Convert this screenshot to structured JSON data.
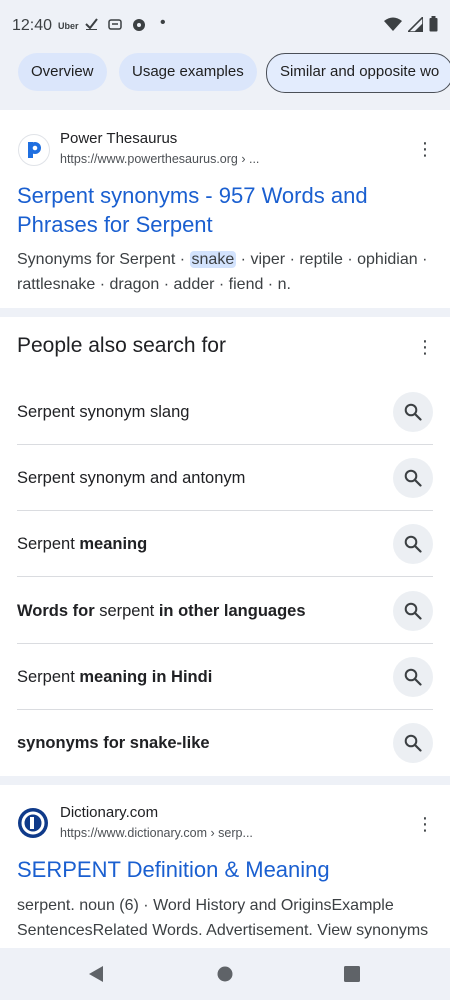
{
  "status": {
    "time": "12:40",
    "notif_uber": "Uber",
    "dot": "•"
  },
  "chips": [
    "Overview",
    "Usage examples",
    "Similar and opposite wo"
  ],
  "result1": {
    "site": "Power Thesaurus",
    "url": "https://www.powerthesaurus.org › ...",
    "title": "Serpent synonyms - 957 Words and Phrases for Serpent",
    "snippet_pre": "Synonyms for Serpent · ",
    "snippet_hl": "snake",
    "snippet_post": " · viper · reptile · ophidian · rattlesnake · dragon · adder · fiend · n."
  },
  "people_also_search": {
    "title": "People also search for",
    "items": [
      {
        "parts": [
          {
            "t": "Serpent synonym slang",
            "b": false
          }
        ]
      },
      {
        "parts": [
          {
            "t": "Serpent synonym and antonym",
            "b": false
          }
        ]
      },
      {
        "parts": [
          {
            "t": "Serpent ",
            "b": false
          },
          {
            "t": "meaning",
            "b": true
          }
        ]
      },
      {
        "parts": [
          {
            "t": "Words for",
            "b": true
          },
          {
            "t": " serpent ",
            "b": false
          },
          {
            "t": "in other languages",
            "b": true
          }
        ]
      },
      {
        "parts": [
          {
            "t": "Serpent ",
            "b": false
          },
          {
            "t": "meaning in Hindi",
            "b": true
          }
        ]
      },
      {
        "parts": [
          {
            "t": "synonyms for snake-like",
            "b": true
          }
        ]
      }
    ]
  },
  "result2": {
    "site": "Dictionary.com",
    "url": "https://www.dictionary.com › serp...",
    "title": "SERPENT Definition & Meaning",
    "snippet": "serpent. noun (6) · Word History and OriginsExample SentencesRelated Words. Advertisement. View synonyms for serpent · serpent · British Dictionary"
  },
  "colors": {
    "link": "#1a5fd0",
    "bg_tint": "#eef1f7",
    "chip": "#dbe6fb"
  }
}
